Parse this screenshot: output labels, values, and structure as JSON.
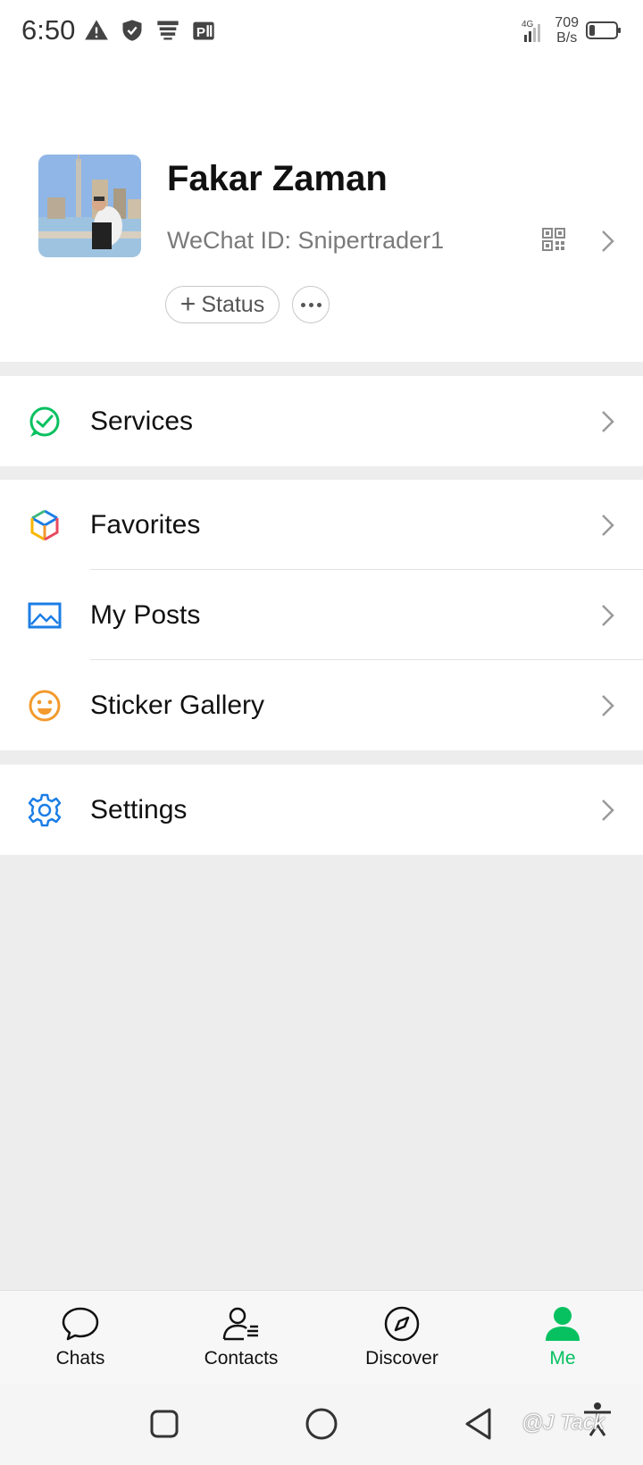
{
  "status_bar": {
    "time": "6:50",
    "net_speed_value": "709",
    "net_speed_unit": "B/s"
  },
  "profile": {
    "name": "Fakar Zaman",
    "wechat_id": "WeChat ID: Snipertrader1",
    "status_button_label": "Status"
  },
  "menu": {
    "services": "Services",
    "favorites": "Favorites",
    "my_posts": "My Posts",
    "sticker_gallery": "Sticker Gallery",
    "settings": "Settings"
  },
  "tab_bar": {
    "chats": "Chats",
    "contacts": "Contacts",
    "discover": "Discover",
    "me": "Me",
    "active": "me"
  },
  "watermark": "@J Tack",
  "colors": {
    "accent": "#07c160",
    "blue_icon": "#1c7ee6",
    "orange_icon": "#f29a2e"
  }
}
